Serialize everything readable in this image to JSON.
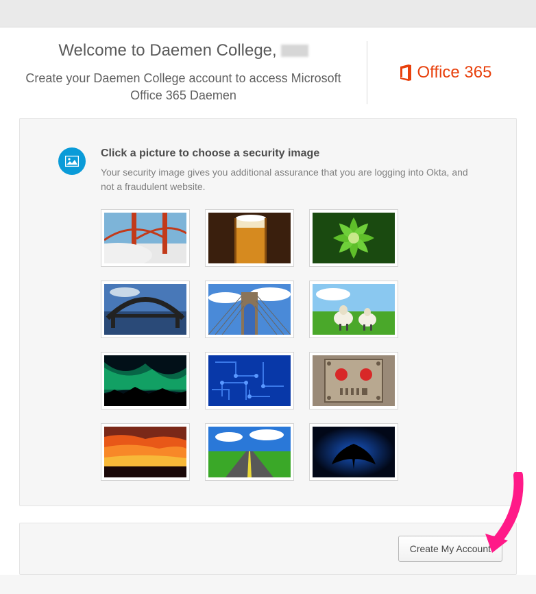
{
  "header": {
    "welcome_prefix": "Welcome to Daemen College,",
    "subtitle": "Create your Daemen College account to access Microsoft Office 365 Daemen",
    "brand": "Office 365"
  },
  "security": {
    "title": "Click a picture to choose a security image",
    "description": "Your security image gives you additional assurance that you are logging into Okta, and not a fraudulent website.",
    "images": [
      "golden-gate-bridge",
      "beer-glass",
      "green-succulent",
      "harbour-bridge",
      "brooklyn-bridge",
      "sheep-field",
      "aurora-borealis",
      "circuit-board",
      "robot-face",
      "sunset-clouds",
      "open-road",
      "manta-ray"
    ]
  },
  "footer": {
    "create_label": "Create My Account"
  }
}
